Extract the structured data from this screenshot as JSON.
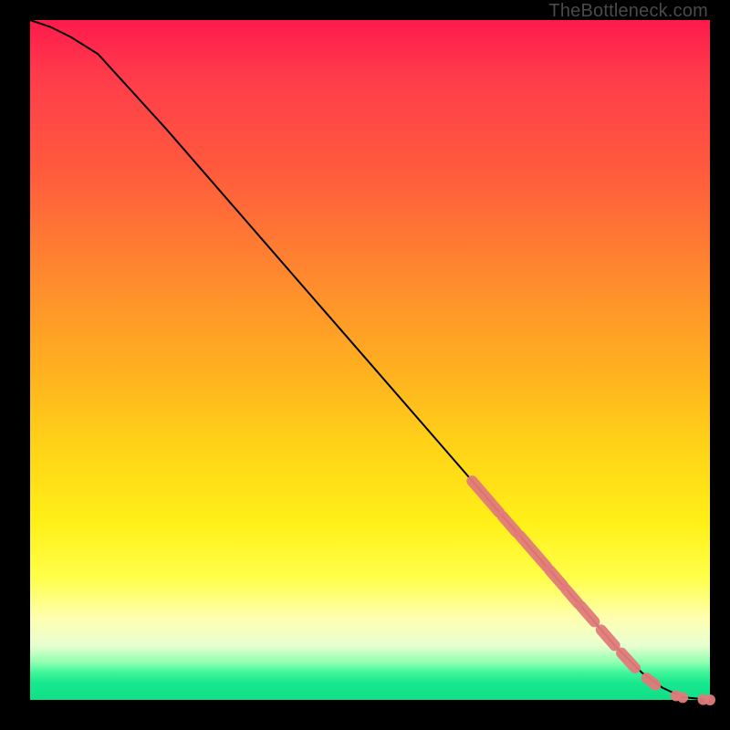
{
  "watermark": "TheBottleneck.com",
  "chart_data": {
    "type": "line",
    "title": "",
    "xlabel": "",
    "ylabel": "",
    "xlim": [
      0,
      100
    ],
    "ylim": [
      0,
      100
    ],
    "series": [
      {
        "name": "curve",
        "x": [
          0,
          3,
          6,
          10,
          20,
          30,
          40,
          50,
          60,
          70,
          80,
          86,
          90,
          93,
          96,
          100
        ],
        "y": [
          100,
          99,
          97.5,
          95,
          84,
          72.5,
          61,
          49.5,
          38,
          26.5,
          15,
          8,
          4,
          1.8,
          0.4,
          0
        ]
      }
    ],
    "highlight_segments": [
      {
        "x0": 65,
        "y0": 32.2,
        "x1": 69,
        "y1": 27.6
      },
      {
        "x0": 69.5,
        "y0": 27.0,
        "x1": 71.5,
        "y1": 24.7
      },
      {
        "x0": 72.0,
        "y0": 24.2,
        "x1": 76.0,
        "y1": 19.6
      },
      {
        "x0": 76.4,
        "y0": 19.1,
        "x1": 78.4,
        "y1": 16.8
      },
      {
        "x0": 78.8,
        "y0": 16.3,
        "x1": 80.6,
        "y1": 14.2
      },
      {
        "x0": 81.0,
        "y0": 13.8,
        "x1": 83.0,
        "y1": 11.5
      },
      {
        "x0": 84.0,
        "y0": 10.3,
        "x1": 86.0,
        "y1": 8.0
      },
      {
        "x0": 87.0,
        "y0": 6.9,
        "x1": 89.0,
        "y1": 4.7
      },
      {
        "x0": 90.7,
        "y0": 3.2,
        "x1": 92.0,
        "y1": 2.2
      }
    ],
    "highlight_points": [
      {
        "x": 95.0,
        "y": 0.6
      },
      {
        "x": 96.0,
        "y": 0.35
      },
      {
        "x": 99.0,
        "y": 0.05
      },
      {
        "x": 100.0,
        "y": 0.0
      }
    ]
  }
}
